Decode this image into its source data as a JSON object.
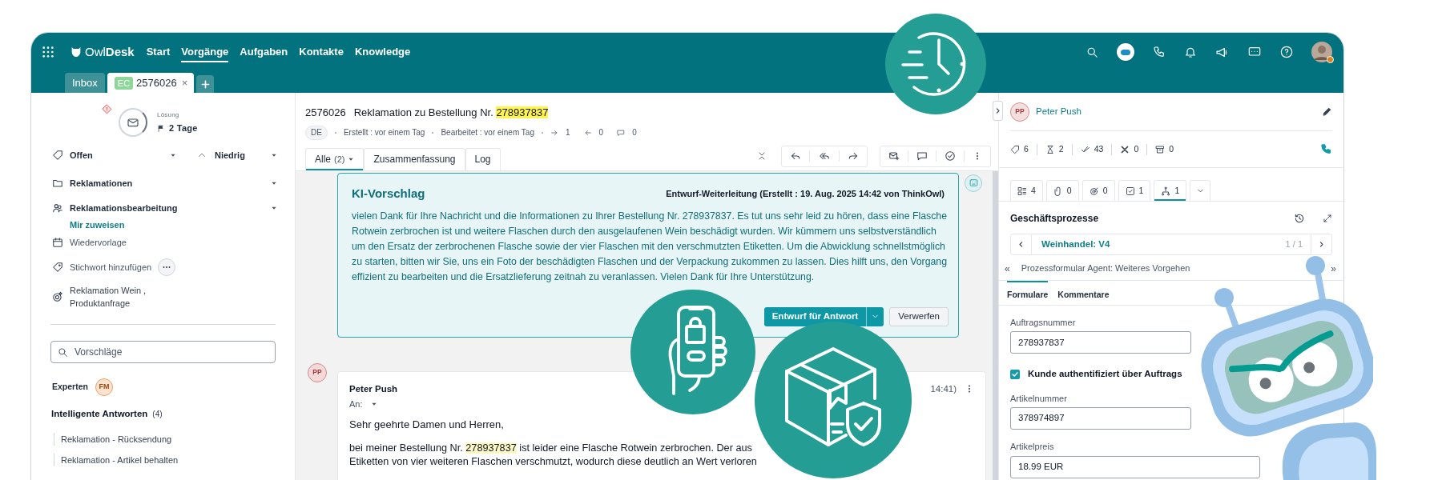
{
  "nav": {
    "brand": "Owl**Desk**",
    "items": [
      {
        "label": "Start",
        "selected": false
      },
      {
        "label": "Vorgänge",
        "selected": true
      },
      {
        "label": "Aufgaben",
        "selected": false
      },
      {
        "label": "Kontakte",
        "selected": false
      },
      {
        "label": "Knowledge",
        "selected": false
      }
    ]
  },
  "tabs": [
    {
      "kind": "inbox",
      "label": "Inbox",
      "selected": false
    },
    {
      "kind": "ticket",
      "badge": "EC",
      "label": "2576026",
      "close": "×",
      "selected": true
    }
  ],
  "sidebar": {
    "sla_label": "Lösung",
    "sla_value": "2 Tage",
    "status": "Offen",
    "priority": "Niedrig",
    "category": "Reklamationen",
    "team": "Reklamationsbearbeitung",
    "assign_link": "Mir zuweisen",
    "followup": "Wiedervorlage",
    "tag_placeholder": "Stichwort hinzufügen",
    "topics": [
      "Reklamation Wein ,",
      "Produktanfrage"
    ],
    "search": {
      "placeholder": "Vorschläge"
    },
    "experts": {
      "label": "Experten",
      "initials": "FM"
    },
    "smart_answers": {
      "title": "Intelligente Antworten",
      "count": "(4)",
      "items": [
        "Reklamation - Rücksendung",
        "Reklamation - Artikel behalten"
      ]
    }
  },
  "ticket": {
    "id": "2576026",
    "title": "Reklamation zu Bestellung Nr.",
    "order_number": "278937837",
    "language": "DE",
    "created": "Erstellt : vor einem Tag",
    "edited": "Bearbeitet : vor einem Tag",
    "outgoing": "1",
    "incoming": "0",
    "comments": "0"
  },
  "view_tabs": [
    {
      "label": "Alle",
      "count": "(2)",
      "selected": true
    },
    {
      "label": "Zusammenfassung",
      "selected": false
    },
    {
      "label": "Log",
      "selected": false
    }
  ],
  "ai_suggestion": {
    "title": "KI-Vorschlag",
    "meta": "Entwurf-Weiterleitung (Erstellt : 19. Aug. 2025 14:42 von ThinkOwl)",
    "body": "vielen Dank für Ihre Nachricht und die Informationen zu Ihrer Bestellung Nr. 278937837. Es tut uns sehr leid zu hören, dass eine Flasche Rotwein zerbrochen ist und weitere Flaschen durch den ausgelaufenen Wein beschädigt wurden. Wir kümmern uns selbstverständlich um den Ersatz der zerbrochenen Flasche sowie der vier Flaschen mit den verschmutzten Etiketten. Um die Abwicklung schnellstmöglich zu starten, bitten wir Sie, uns ein Foto der beschädigten Flaschen und der Verpackung zukommen zu lassen. Dies hilft uns, den Vorgang effizient zu bearbeiten und die Ersatzlieferung zeitnah zu veranlassen. Vielen Dank für Ihre Unterstützung.",
    "primary": "Entwurf für Antwort",
    "secondary": "Verwerfen"
  },
  "email": {
    "initials": "PP",
    "sender": "Peter Push",
    "to_label": "An:",
    "time": "14:41)",
    "greeting": "Sehr geehrte Damen und Herren,",
    "before": "bei meiner Bestellung Nr.",
    "order_number": "278937837",
    "after": "ist leider eine Flasche Rotwein zerbrochen. Der aus",
    "line2": "Etiketten von vier weiteren Flaschen verschmutzt, wodurch diese deutlich an Wert verloren"
  },
  "contact": {
    "initials": "PP",
    "name": "Peter Push"
  },
  "stats": [
    {
      "kind": "tag",
      "value": "6"
    },
    {
      "kind": "hourglass",
      "value": "2"
    },
    {
      "kind": "done",
      "value": "43"
    },
    {
      "kind": "cancelled",
      "value": "0"
    },
    {
      "kind": "archive",
      "value": "0"
    }
  ],
  "panel_tabs": [
    {
      "kind": "grid",
      "count": "4",
      "selected": false
    },
    {
      "kind": "clip",
      "count": "0",
      "selected": false
    },
    {
      "kind": "target",
      "count": "0",
      "selected": false
    },
    {
      "kind": "task",
      "count": "1",
      "selected": false
    },
    {
      "kind": "flow",
      "count": "1",
      "selected": true
    }
  ],
  "processes": {
    "title": "Geschäftsprozesse",
    "current": "Weinhandel: V4",
    "pager": "1 / 1",
    "prev": "«",
    "form_title": "Prozessformular Agent: Weiteres Vorgehen",
    "next": "»",
    "form_tabs": [
      {
        "label": "Formulare",
        "selected": true
      },
      {
        "label": "Kommentare",
        "selected": false
      }
    ],
    "fields": [
      {
        "kind": "text",
        "label": "Auftragsnummer",
        "value": "278937837"
      },
      {
        "kind": "checkbox",
        "label": "Kunde authentifiziert über Auftrags",
        "checked": true
      },
      {
        "kind": "text",
        "label": "Artikelnummer",
        "value": "378974897"
      },
      {
        "kind": "text",
        "label": "Artikelpreis",
        "value": "18.99 EUR"
      }
    ]
  }
}
